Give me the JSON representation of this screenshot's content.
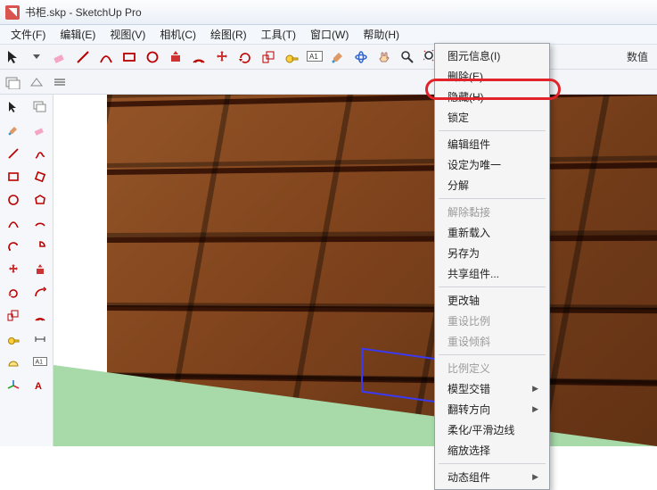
{
  "window": {
    "title": "书柜.skp - SketchUp Pro"
  },
  "menu": {
    "file": "文件(F)",
    "edit": "编辑(E)",
    "view": "视图(V)",
    "camera": "相机(C)",
    "draw": "绘图(R)",
    "tools": "工具(T)",
    "window": "窗口(W)",
    "help": "帮助(H)"
  },
  "toolbar_cut": "数值",
  "context": {
    "model_info": "图元信息(I)",
    "delete": "删除(E)",
    "hide": "隐藏(H)",
    "lock": "锁定",
    "edit_component": "编辑组件",
    "make_unique": "设定为唯一",
    "explode": "分解",
    "unglue": "解除黏接",
    "reload": "重新载入",
    "save_as": "另存为",
    "share_component": "共享组件...",
    "change_axes": "更改轴",
    "reset_scale": "重设比例",
    "reset_skew": "重设倾斜",
    "scale_definition": "比例定义",
    "intersect": "模型交错",
    "flip": "翻转方向",
    "soften": "柔化/平滑边线",
    "zoom_selection": "缩放选择",
    "dynamic": "动态组件"
  }
}
